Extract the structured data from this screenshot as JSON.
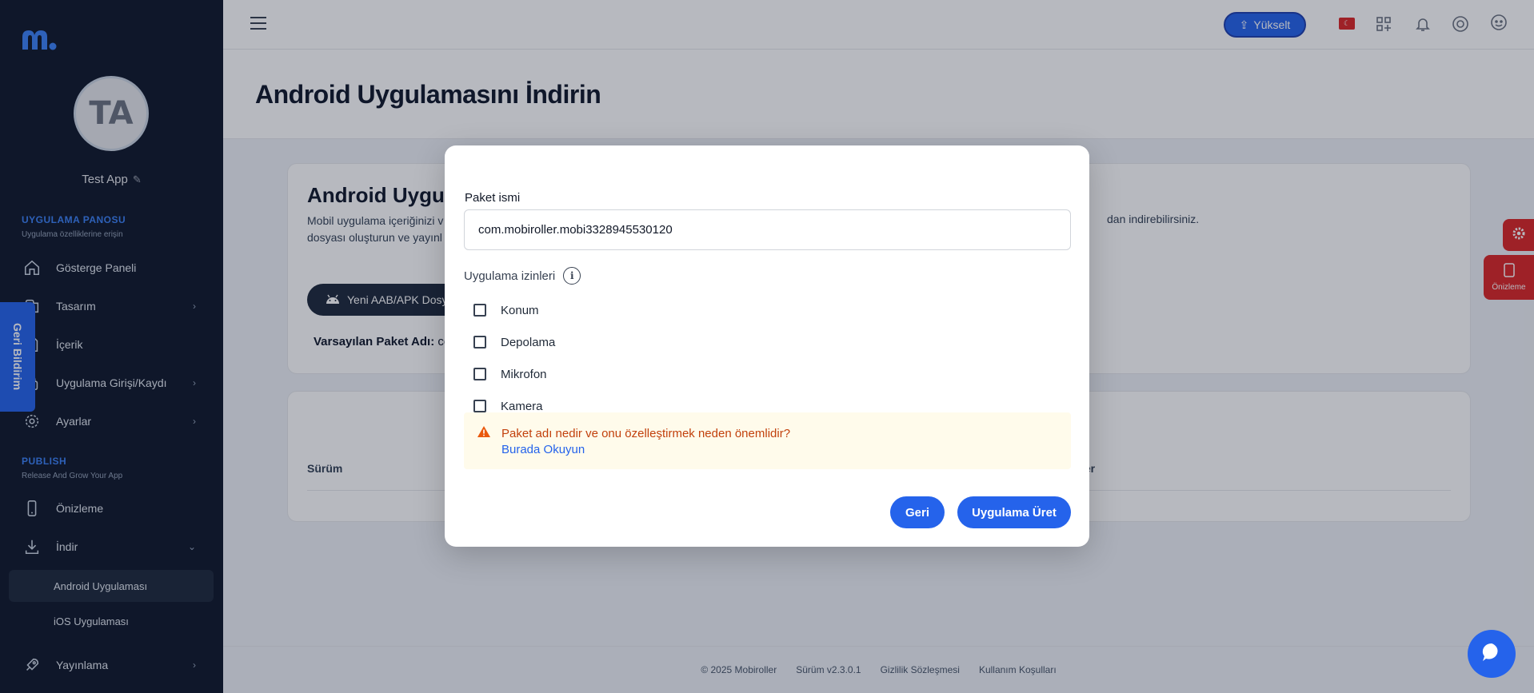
{
  "sidebar": {
    "avatar_initials": "TA",
    "app_name": "Test App",
    "section1": {
      "title": "UYGULAMA PANOSU",
      "subtitle": "Uygulama özelliklerine erişin"
    },
    "section2": {
      "title": "PUBLISH",
      "subtitle": "Release And Grow Your App"
    },
    "items": [
      {
        "label": "Gösterge Paneli",
        "icon": "home-icon"
      },
      {
        "label": "Tasarım",
        "icon": "palette-icon"
      },
      {
        "label": "İçerik",
        "icon": "content-icon"
      },
      {
        "label": "Uygulama Girişi/Kaydı",
        "icon": "login-icon"
      },
      {
        "label": "Ayarlar",
        "icon": "gear-icon"
      },
      {
        "label": "Önizleme",
        "icon": "phone-icon"
      },
      {
        "label": "İndir",
        "icon": "download-icon"
      },
      {
        "label": "Yayınlama",
        "icon": "rocket-icon"
      }
    ],
    "sub_items": [
      "Android Uygulaması",
      "iOS Uygulaması"
    ]
  },
  "feedback_tab": "Geri Bildirim",
  "topbar": {
    "upgrade_label": "Yükselt"
  },
  "page": {
    "title": "Android Uygulamasını İndirin",
    "card_title": "Android Uygul",
    "card_text_line1": "Mobil uygulama içeriğinizi v",
    "card_text_line2": "dosyası oluşturun ve yayınl",
    "card_text_right": "dan indirebilirsiniz.",
    "new_button": "Yeni AAB/APK Dosy",
    "default_pkg_label": "Varsayılan Paket Adı:",
    "default_pkg_value": "co",
    "table_header_left": "Sürüm",
    "table_header_right": "ler"
  },
  "footer": {
    "copyright": "© 2025 Mobiroller",
    "version": "Sürüm v2.3.0.1",
    "privacy": "Gizlilik Sözleşmesi",
    "terms": "Kullanım Koşulları"
  },
  "floating": {
    "preview_label": "Önizleme"
  },
  "modal": {
    "package_label": "Paket ismi",
    "package_value": "com.mobiroller.mobi3328945530120",
    "permissions_label": "Uygulama izinleri",
    "permissions": [
      {
        "label": "Konum",
        "checked": false
      },
      {
        "label": "Depolama",
        "checked": false
      },
      {
        "label": "Mikrofon",
        "checked": false
      },
      {
        "label": "Kamera",
        "checked": false
      }
    ],
    "notice_text": "Paket adı nedir ve onu özelleştirmek neden önemlidir?",
    "notice_link": "Burada Okuyun",
    "back_button": "Geri",
    "create_button": "Uygulama Üret"
  },
  "colors": {
    "primary": "#2563eb",
    "sidebar_bg": "#0f172a",
    "warning_text": "#c2410c",
    "warning_bg": "#fffbeb",
    "float_red": "#dc2626"
  }
}
